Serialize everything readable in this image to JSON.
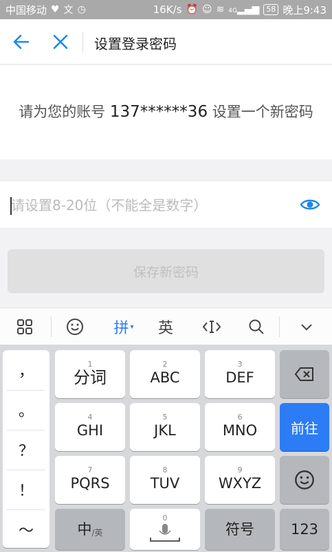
{
  "status_bar": {
    "carrier": "中国移动",
    "speed": "16K/s",
    "signal": "4G",
    "battery": "58",
    "time": "晚上9:43"
  },
  "header": {
    "title": "设置登录密码",
    "back_icon": "arrow-left-icon",
    "close_icon": "close-icon"
  },
  "info": {
    "prefix": "请为您的账号",
    "account": "137******36",
    "suffix": "设置一个新密码"
  },
  "password_field": {
    "value": "",
    "placeholder": "请设置8-20位（不能全是数字）"
  },
  "save_button": {
    "label": "保存新密码"
  },
  "keyboard": {
    "toolbar": {
      "pinyin": "拼",
      "english": "英"
    },
    "punctuation": [
      "，",
      "。",
      "？",
      "！",
      "～"
    ],
    "row1": [
      {
        "num": "1",
        "label": "分词"
      },
      {
        "num": "2",
        "label": "ABC"
      },
      {
        "num": "3",
        "label": "DEF"
      }
    ],
    "row2": [
      {
        "num": "4",
        "label": "GHI"
      },
      {
        "num": "5",
        "label": "JKL"
      },
      {
        "num": "6",
        "label": "MNO"
      }
    ],
    "row3": [
      {
        "num": "7",
        "label": "PQRS"
      },
      {
        "num": "8",
        "label": "TUV"
      },
      {
        "num": "9",
        "label": "WXYZ"
      }
    ],
    "row4": {
      "cn": "中",
      "cn_sub": "/英",
      "space_num": "0",
      "symbols": "符号",
      "num123": "123"
    },
    "go": "前往"
  },
  "colors": {
    "accent": "#2c7cf6",
    "icon_blue": "#1e88e5"
  }
}
